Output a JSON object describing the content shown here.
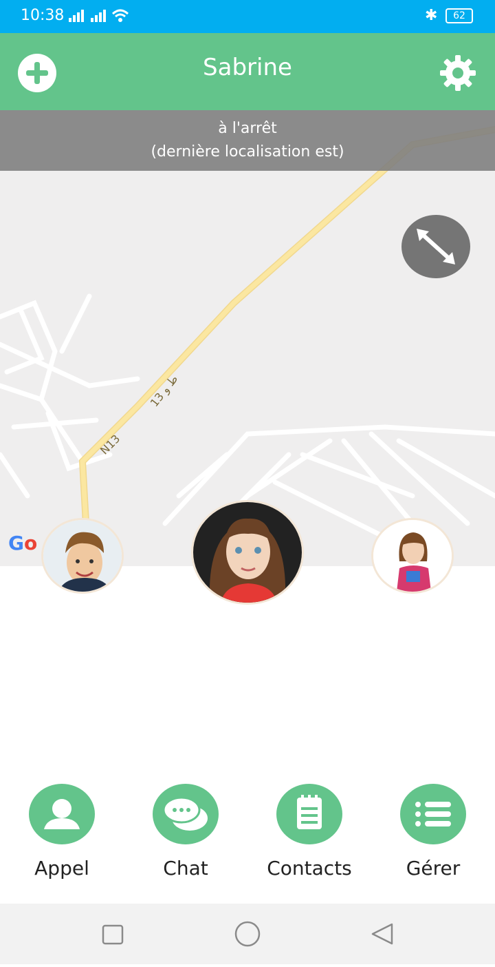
{
  "statusbar": {
    "time": "10:38",
    "battery": "62"
  },
  "header": {
    "title": "Sabrine"
  },
  "status": {
    "line1": "à l'arrêt",
    "line2": "(dernière localisation est)"
  },
  "map": {
    "road_label_1": "13 ﻁ و",
    "road_label_2": "N13",
    "google_logo": "Go"
  },
  "actions": [
    {
      "label": "Appel",
      "icon": "person-icon"
    },
    {
      "label": "Chat",
      "icon": "chat-bubbles-icon"
    },
    {
      "label": "Contacts",
      "icon": "notepad-icon"
    },
    {
      "label": "Gérer",
      "icon": "list-icon"
    }
  ],
  "colors": {
    "statusbar": "#02aef0",
    "accent_green": "#63c48b",
    "overlay_gray": "#808080",
    "map_road": "#fbe7a1"
  }
}
